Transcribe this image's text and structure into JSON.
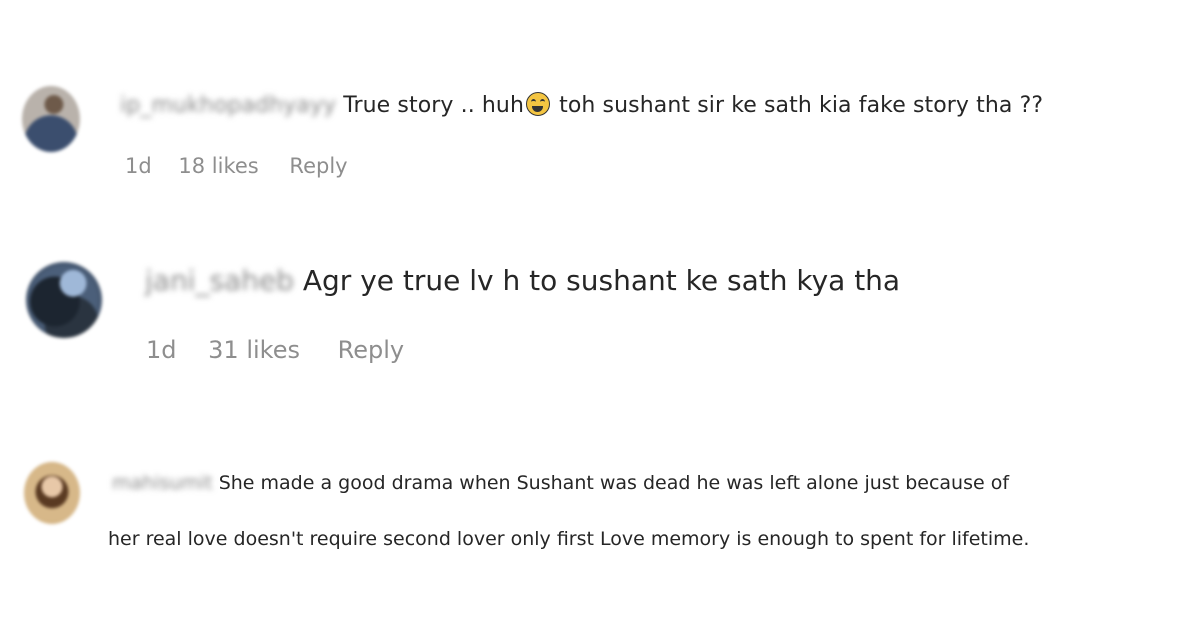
{
  "comments": [
    {
      "username": "ip_mukhopadhyayy",
      "text_before_emoji": "True story .. huh",
      "emoji": "grinning-squinting-face",
      "text_after_emoji": " toh sushant sir ke sath kia fake story tha ??",
      "time": "1d",
      "likes": "18 likes",
      "reply_label": "Reply"
    },
    {
      "username": "jani_saheb",
      "text": "Agr ye true lv h to sushant ke sath kya tha",
      "time": "1d",
      "likes": "31 likes",
      "reply_label": "Reply"
    },
    {
      "username": "mahisumit",
      "text_line1": "She made a good drama when Sushant was dead he was left alone just because of",
      "text_line2": "her real love doesn't require second lover only first Love memory is enough to spent for lifetime."
    }
  ]
}
